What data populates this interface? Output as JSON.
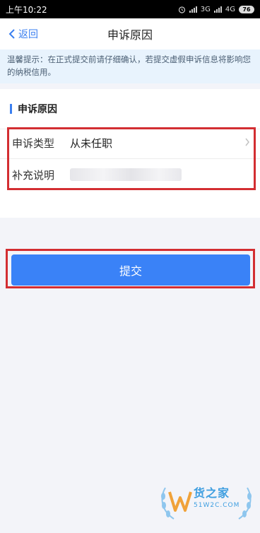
{
  "status_bar": {
    "time": "上午10:22",
    "network_3g": "3G",
    "network_4g": "4G",
    "battery": "76"
  },
  "nav": {
    "back_label": "返回",
    "title": "申诉原因"
  },
  "notice": {
    "text": "温馨提示：在正式提交前请仔细确认，若提交虚假申诉信息将影响您的纳税信用。"
  },
  "section": {
    "title": "申诉原因"
  },
  "form": {
    "appeal_type": {
      "label": "申诉类型",
      "value": "从未任职"
    },
    "supplement": {
      "label": "补充说明",
      "value_blurred": true
    }
  },
  "submit": {
    "label": "提交"
  },
  "colors": {
    "accent": "#3a82f7",
    "highlight": "#d32e32",
    "notice_bg": "#e8f3fd"
  },
  "watermark": {
    "main": "货之家",
    "sub": "51W2C.COM"
  }
}
